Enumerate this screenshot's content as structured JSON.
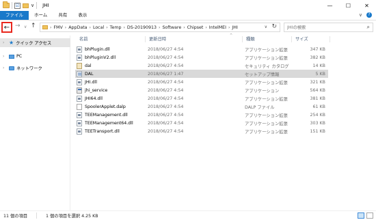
{
  "window": {
    "title": "JHI",
    "minimize_icon": "minimize-icon",
    "maximize_icon": "maximize-icon",
    "close_icon": "close-icon",
    "minimize_glyph": "—",
    "maximize_glyph": "☐",
    "close_glyph": "✕"
  },
  "quick_access_toolbar": {
    "check_glyph": "☑",
    "dropdown_glyph": "∨"
  },
  "ribbon": {
    "tabs": [
      {
        "label": "ファイル"
      },
      {
        "label": "ホーム"
      },
      {
        "label": "共有"
      },
      {
        "label": "表示"
      }
    ],
    "expand_glyph": "∨",
    "help_glyph": "?"
  },
  "navigation": {
    "back_glyph": "←",
    "forward_glyph": "→",
    "recent_glyph": "∨",
    "up_glyph": "↑",
    "address_dropdown_glyph": "∨",
    "refresh_glyph": "↻",
    "breadcrumbs": [
      "FMV",
      "AppData",
      "Local",
      "Temp",
      "DS-20190913",
      "Software",
      "Chipset",
      "IntelMEI",
      "JHI"
    ],
    "crumb_separator": "›",
    "search_placeholder": "JHIの検索",
    "search_glyph": "⌕"
  },
  "nav_pane": {
    "items": [
      {
        "label": "クイック アクセス",
        "icon": "star-icon",
        "glyph": "★",
        "selected": true
      },
      {
        "label": "PC",
        "icon": "pc-icon",
        "selected": false
      },
      {
        "label": "ネットワーク",
        "icon": "network-icon",
        "selected": false
      }
    ],
    "chevron_glyph": "›"
  },
  "file_list": {
    "columns": {
      "name": "名前",
      "date": "更新日時",
      "type": "種類",
      "size": "サイズ"
    },
    "sort_glyph": "^",
    "rows": [
      {
        "name": "bhPlugin.dll",
        "date": "2018/06/27 4:54",
        "type": "アプリケーション拡張",
        "size": "347 KB",
        "icon": "dll-file-icon"
      },
      {
        "name": "bhPluginV2.dll",
        "date": "2018/06/27 4:54",
        "type": "アプリケーション拡張",
        "size": "382 KB",
        "icon": "dll-file-icon"
      },
      {
        "name": "dal",
        "date": "2018/06/27 4:54",
        "type": "セキュリティ カタログ",
        "size": "14 KB",
        "icon": "catalog-file-icon"
      },
      {
        "name": "DAL",
        "date": "2018/06/27 1:47",
        "type": "セットアップ情報",
        "size": "5 KB",
        "icon": "setup-info-file-icon",
        "selected": true
      },
      {
        "name": "JHI.dll",
        "date": "2018/06/27 4:54",
        "type": "アプリケーション拡張",
        "size": "321 KB",
        "icon": "dll-file-icon"
      },
      {
        "name": "jhi_service",
        "date": "2018/06/27 4:54",
        "type": "アプリケーション",
        "size": "564 KB",
        "icon": "application-file-icon"
      },
      {
        "name": "JHI64.dll",
        "date": "2018/06/27 4:54",
        "type": "アプリケーション拡張",
        "size": "381 KB",
        "icon": "dll-file-icon"
      },
      {
        "name": "SpoolerApplet.dalp",
        "date": "2018/06/27 4:54",
        "type": "DALP ファイル",
        "size": "61 KB",
        "icon": "generic-file-icon"
      },
      {
        "name": "TEEManagement.dll",
        "date": "2018/06/27 4:54",
        "type": "アプリケーション拡張",
        "size": "254 KB",
        "icon": "dll-file-icon"
      },
      {
        "name": "TEEManagement64.dll",
        "date": "2018/06/27 4:54",
        "type": "アプリケーション拡張",
        "size": "303 KB",
        "icon": "dll-file-icon"
      },
      {
        "name": "TEETransport.dll",
        "date": "2018/06/27 4:54",
        "type": "アプリケーション拡張",
        "size": "151 KB",
        "icon": "dll-file-icon"
      }
    ]
  },
  "status_bar": {
    "item_count": "11 個の項目",
    "selection": "1 個の項目を選択  4.25 KB"
  },
  "colors": {
    "accent": "#1979ca",
    "highlight_back_button": "#e8261c",
    "selected_row": "#d9d9d9"
  }
}
